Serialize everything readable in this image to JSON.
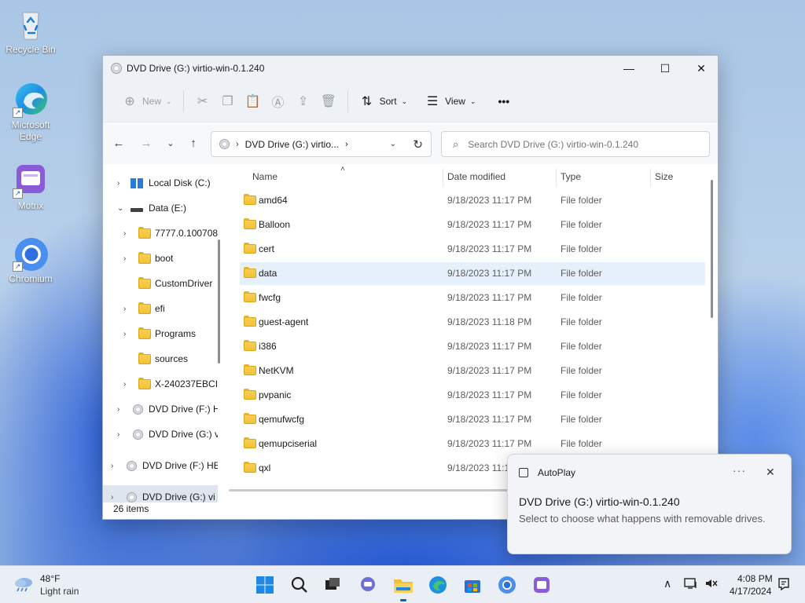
{
  "desktop": {
    "icons": [
      {
        "label": "Recycle Bin",
        "icon": "recycle-bin-icon"
      },
      {
        "label": "Microsoft Edge",
        "icon": "edge-icon"
      },
      {
        "label": "Motrix",
        "icon": "motrix-icon"
      },
      {
        "label": "Chromium",
        "icon": "chromium-icon"
      }
    ]
  },
  "window": {
    "title": "DVD Drive (G:) virtio-win-0.1.240",
    "controls": {
      "minimize": "—",
      "maximize": "☐",
      "close": "✕"
    }
  },
  "toolbar": {
    "new_label": "New",
    "sort_label": "Sort",
    "view_label": "View",
    "more_label": "•••"
  },
  "address": {
    "path": "DVD Drive (G:) virtio...",
    "search_placeholder": "Search DVD Drive (G:) virtio-win-0.1.240"
  },
  "nav": {
    "items": [
      {
        "label": "Local Disk (C:)",
        "icon": "windows-drive-icon",
        "arrow": "›"
      },
      {
        "label": "Data (E:)",
        "icon": "drive-icon",
        "arrow": "⌄"
      },
      {
        "label": "7777.0.100708",
        "icon": "folder-icon",
        "arrow": "›"
      },
      {
        "label": "boot",
        "icon": "folder-icon",
        "arrow": "›"
      },
      {
        "label": "CustomDriver",
        "icon": "folder-icon",
        "arrow": ""
      },
      {
        "label": "efi",
        "icon": "folder-icon",
        "arrow": "›"
      },
      {
        "label": "Programs",
        "icon": "folder-icon",
        "arrow": "›"
      },
      {
        "label": "sources",
        "icon": "folder-icon",
        "arrow": ""
      },
      {
        "label": "X-240237EBCI",
        "icon": "folder-icon",
        "arrow": "›"
      },
      {
        "label": "DVD Drive (F:) H",
        "icon": "dvd-icon",
        "arrow": "›"
      },
      {
        "label": "DVD Drive (G:) v",
        "icon": "dvd-icon",
        "arrow": "›"
      },
      {
        "label": "DVD Drive (F:) HE",
        "icon": "dvd-icon",
        "arrow": "›"
      },
      {
        "label": "DVD Drive (G:) vi",
        "icon": "dvd-icon",
        "arrow": "›"
      }
    ]
  },
  "list": {
    "columns": {
      "name": "Name",
      "date": "Date modified",
      "type": "Type",
      "size": "Size"
    },
    "rows": [
      {
        "name": "amd64",
        "date": "9/18/2023 11:17 PM",
        "type": "File folder"
      },
      {
        "name": "Balloon",
        "date": "9/18/2023 11:17 PM",
        "type": "File folder"
      },
      {
        "name": "cert",
        "date": "9/18/2023 11:17 PM",
        "type": "File folder"
      },
      {
        "name": "data",
        "date": "9/18/2023 11:17 PM",
        "type": "File folder"
      },
      {
        "name": "fwcfg",
        "date": "9/18/2023 11:17 PM",
        "type": "File folder"
      },
      {
        "name": "guest-agent",
        "date": "9/18/2023 11:18 PM",
        "type": "File folder"
      },
      {
        "name": "i386",
        "date": "9/18/2023 11:17 PM",
        "type": "File folder"
      },
      {
        "name": "NetKVM",
        "date": "9/18/2023 11:17 PM",
        "type": "File folder"
      },
      {
        "name": "pvpanic",
        "date": "9/18/2023 11:17 PM",
        "type": "File folder"
      },
      {
        "name": "qemufwcfg",
        "date": "9/18/2023 11:17 PM",
        "type": "File folder"
      },
      {
        "name": "qemupciserial",
        "date": "9/18/2023 11:17 PM",
        "type": "File folder"
      },
      {
        "name": "qxl",
        "date": "9/18/2023 11:1",
        "type": ""
      }
    ]
  },
  "status": {
    "items": "26 items"
  },
  "toast": {
    "app": "AutoPlay",
    "more": "···",
    "close": "✕",
    "title": "DVD Drive (G:) virtio-win-0.1.240",
    "body": "Select to choose what happens with removable drives."
  },
  "taskbar": {
    "weather_temp": "48°F",
    "weather_desc": "Light rain",
    "time": "4:08 PM",
    "date": "4/17/2024"
  }
}
